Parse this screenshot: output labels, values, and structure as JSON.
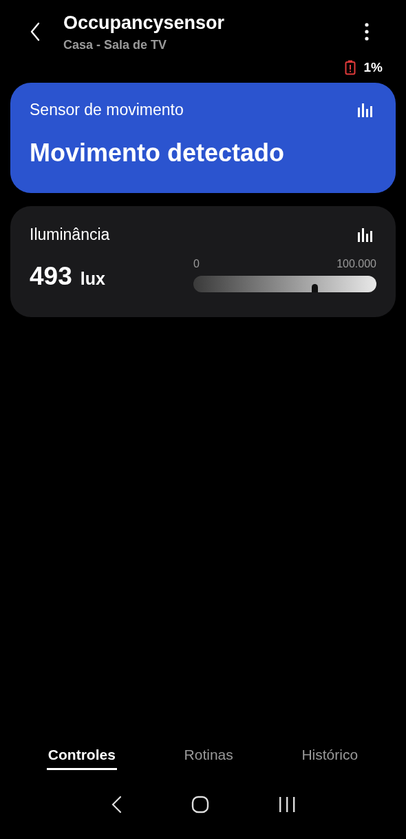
{
  "header": {
    "title": "Occupancysensor",
    "subtitle": "Casa - Sala de TV"
  },
  "battery": {
    "reading": "1%",
    "low": true
  },
  "cards": [
    {
      "kind": "status",
      "label": "Sensor de movimento",
      "value": "Movimento detectado"
    },
    {
      "kind": "meter",
      "label": "Iluminância",
      "value": "493",
      "unit": "lux",
      "min_label": "0",
      "max_label": "100.000",
      "level": 0.66
    }
  ],
  "tabs": [
    {
      "label": "Controles",
      "selected": true
    },
    {
      "label": "Rotinas",
      "selected": false
    },
    {
      "label": "Histórico",
      "selected": false
    }
  ]
}
